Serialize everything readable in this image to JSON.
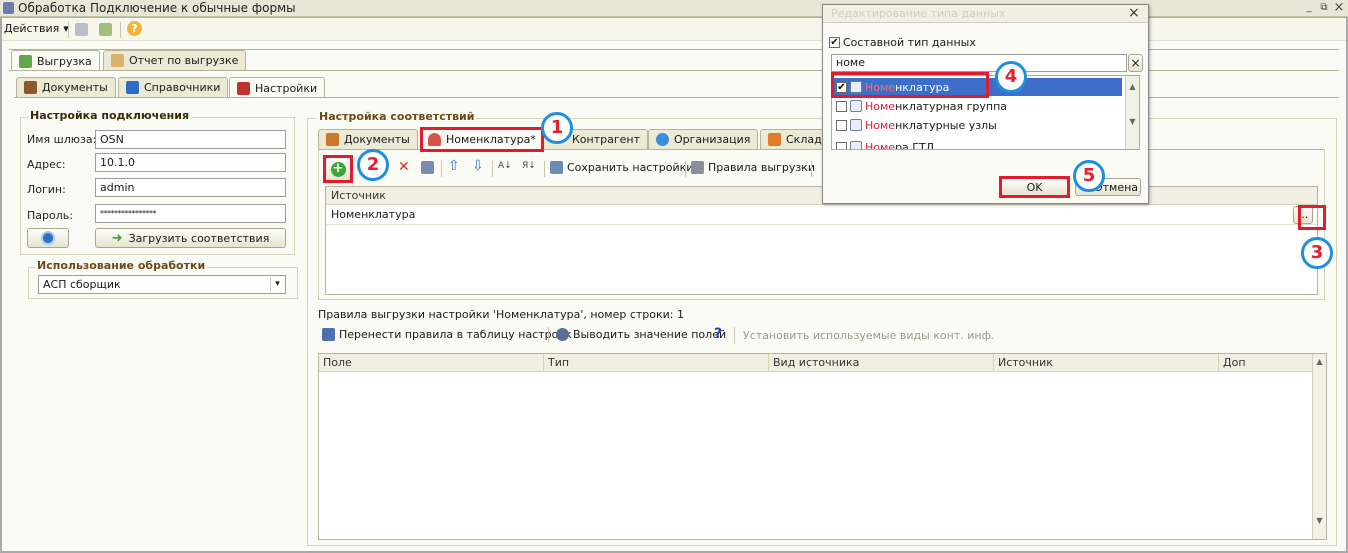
{
  "window": {
    "title": "Обработка  Подключение к обычные формы",
    "app_icon": "app-icon",
    "restore_glyph": "⧉",
    "close_glyph": "×"
  },
  "toolbar": {
    "actions_label": "Действия",
    "actions_glyph": "▾",
    "help_glyph": "?"
  },
  "top_tabs": [
    {
      "label": "Выгрузка",
      "icon": "export-icon"
    },
    {
      "label": "Отчет по выгрузке",
      "icon": "report-icon"
    }
  ],
  "sub_tabs": [
    {
      "label": "Документы",
      "icon": "briefcase-icon"
    },
    {
      "label": "Справочники",
      "icon": "book-icon"
    },
    {
      "label": "Настройки",
      "icon": "settings-icon"
    }
  ],
  "connection": {
    "group_title": "Настройка подключения",
    "gateway_label": "Имя шлюза:",
    "gateway_value": "OSN",
    "address_label": "Адрес:",
    "address_value": "10.1.0",
    "login_label": "Логин:",
    "login_value": "admin",
    "password_label": "Пароль:",
    "password_value": "****************",
    "load_button": "Загрузить соответствия"
  },
  "usage": {
    "group_title": "Использование обработки",
    "value": "АСП сборщик",
    "dropdown_glyph": "▾"
  },
  "mapping": {
    "group_title": "Настройка соответствий",
    "tabs": [
      {
        "label": "Документы",
        "icon": "documents-icon"
      },
      {
        "label": "Номенклатура*",
        "icon": "basket-icon"
      },
      {
        "label": "Контрагент",
        "icon": "partner-icon"
      },
      {
        "label": "Организация",
        "icon": "organization-icon"
      },
      {
        "label": "Склад",
        "icon": "warehouse-icon"
      }
    ],
    "save_settings": "Сохранить настройки",
    "export_rules": "Правила выгрузки",
    "grid_header": "Источник",
    "grid_row": "Номенклатура",
    "ellipsis": "..."
  },
  "rules": {
    "info_text": "Правила выгрузки настройки 'Номенклатура', номер строки: 1",
    "transfer_button": "Перенести правила в таблицу настроек",
    "show_fields_button": "Выводить значение полей",
    "help_glyph": "?",
    "set_kinds_button": "Установить используемые виды конт. инф.",
    "columns": [
      "Поле",
      "Тип",
      "Вид источника",
      "Источник",
      "Доп"
    ]
  },
  "dialog": {
    "title": "Редактирование типа данных",
    "close_glyph": "×",
    "composite_label": "Составной тип данных",
    "search_value": "номе",
    "clear_glyph": "×",
    "items": [
      {
        "prefix": "Номе",
        "suffix": "нклатура",
        "checked": true,
        "selected": true
      },
      {
        "prefix": "Номе",
        "suffix": "нклатурная группа",
        "checked": false,
        "selected": false
      },
      {
        "prefix": "Номе",
        "suffix": "нклатурные узлы",
        "checked": false,
        "selected": false
      },
      {
        "prefix": "Номе",
        "suffix": "ра ГТД",
        "checked": false,
        "selected": false
      }
    ],
    "check_glyph": "✔",
    "ok_button": "OK",
    "cancel_button": "Отмена"
  },
  "callouts": [
    "1",
    "2",
    "3",
    "4",
    "5"
  ],
  "scroll_glyphs": {
    "up": "▲",
    "down": "▼"
  },
  "arrow_glyphs": {
    "up": "⇧",
    "down": "⇩",
    "delete": "✕",
    "sort_az": "A↓",
    "sort_za": "Я↓",
    "add": "+"
  },
  "colors": {
    "accent_red": "#e21c2c",
    "callout_blue": "#1e8ee0",
    "selection": "#3d6ec9"
  }
}
